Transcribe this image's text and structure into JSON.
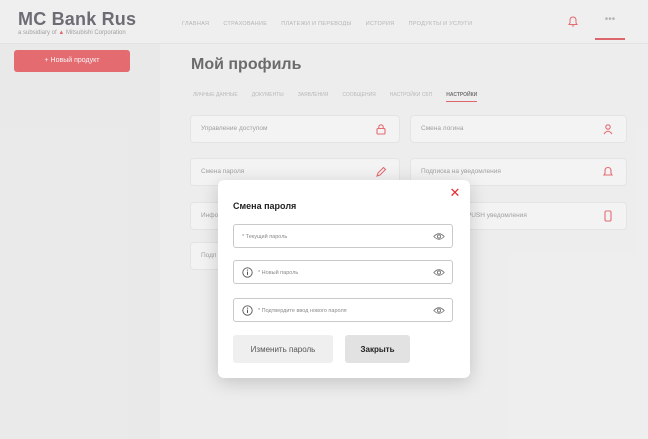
{
  "brand": {
    "name": "MC Bank Rus",
    "subtitle_prefix": "a subsidiary of",
    "subtitle_group": "Mitsubishi Corporation",
    "accent_color": "#e32b33"
  },
  "header": {
    "nav": [
      "Главная",
      "Страхование",
      "Платежи и переводы",
      "История",
      "Продукты и услуги"
    ],
    "bell_icon": "bell-icon",
    "more_label": "•••"
  },
  "sidebar": {
    "new_product_label": "+ Новый продукт"
  },
  "main": {
    "title": "Мой профиль",
    "tabs": [
      {
        "label": "Личные данные",
        "active": false
      },
      {
        "label": "Документы",
        "active": false
      },
      {
        "label": "Заявления",
        "active": false
      },
      {
        "label": "Сообщения",
        "active": false
      },
      {
        "label": "Настройки СБП",
        "active": false
      },
      {
        "label": "Настройки",
        "active": true
      }
    ],
    "cards": [
      {
        "label": "Управление доступом",
        "icon": "lock-icon"
      },
      {
        "label": "Смена логина",
        "icon": "user-icon"
      },
      {
        "label": "Смена пароля",
        "icon": "pencil-icon"
      },
      {
        "label": "Подписка на уведомления",
        "icon": "bell-icon"
      },
      {
        "label": "Инфо",
        "icon": ""
      },
      {
        "label": "SMS/PUSH уведомления",
        "icon": "phone-icon"
      },
      {
        "label": "Подп",
        "icon": ""
      }
    ]
  },
  "modal": {
    "title": "Смена пароля",
    "close_icon": "close-icon",
    "fields": [
      {
        "placeholder": "* Текущий пароль",
        "value": ""
      },
      {
        "placeholder": "* Новый пароль",
        "value": ""
      },
      {
        "placeholder": "* Подтвердите ввод нового пароля",
        "value": ""
      }
    ],
    "submit_label": "Изменить пароль",
    "close_label": "Закрыть"
  }
}
